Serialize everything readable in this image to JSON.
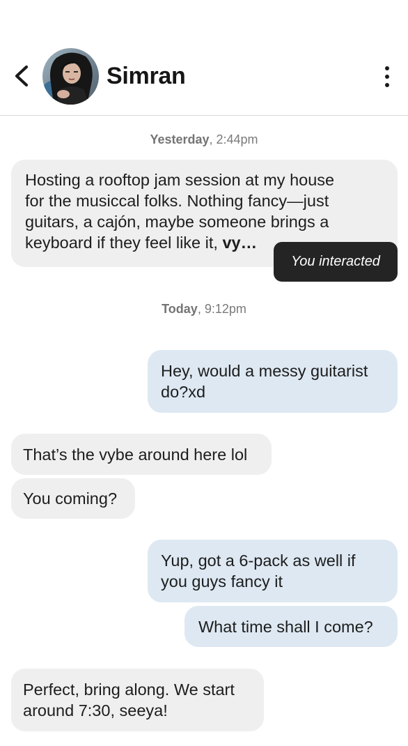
{
  "header": {
    "contact_name": "Simran",
    "back_icon": "chevron-left-icon",
    "menu_icon": "vertical-ellipsis-icon"
  },
  "thread": {
    "day1": {
      "day": "Yesterday",
      "time": ", 2:44pm"
    },
    "msg1": {
      "line1": "Hosting a rooftop jam session at my house",
      "line2": "for the musiccal folks. Nothing fancy—just",
      "line3": "guitars, a cajón, maybe someone brings a",
      "line4_text": "keyboard if they feel like it, ",
      "line4_bold": "vy…"
    },
    "interaction_label": "You interacted",
    "day2": {
      "day": "Today",
      "time": ", 9:12pm"
    },
    "msg2": {
      "line1": "Hey, would a messy guitarist",
      "line2": "do?xd"
    },
    "msg3": "That’s the vybe around here lol",
    "msg4": "You coming?",
    "msg5": {
      "line1": "Yup, got a 6-pack as well if",
      "line2": "you guys fancy it"
    },
    "msg6": "What time shall I come?",
    "msg7": {
      "line1": "Perfect, bring along. We start",
      "line2": "around 7:30, seeya!"
    }
  },
  "colors": {
    "incoming_bubble": "#efefef",
    "outgoing_bubble": "#dde8f2",
    "interaction_pill": "#242424",
    "divider": "#d9d9d9",
    "text": "#1d1d1d",
    "timestamp": "#7a7a7a"
  }
}
